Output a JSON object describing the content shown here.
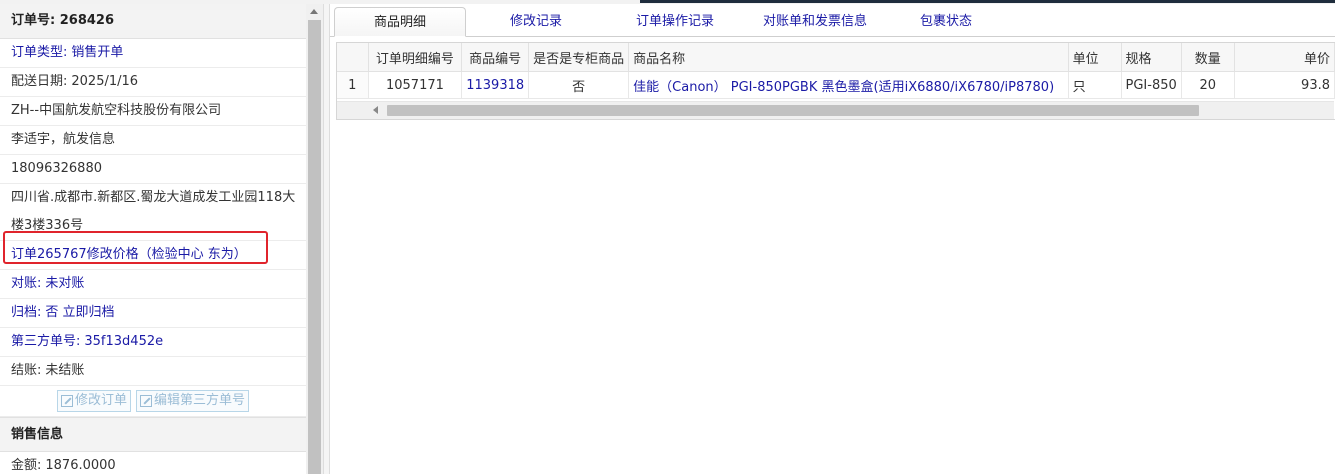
{
  "order": {
    "header_label": "订单号:",
    "number": "268426",
    "type_label": "订单类型:",
    "type_value": "销售开单",
    "delivery_label": "配送日期:",
    "delivery_value": "2025/1/16",
    "company": "ZH--中国航发航空科技股份有限公司",
    "contact": "李适宇，航发信息",
    "phone": "18096326880",
    "address": "四川省.成都市.新都区.蜀龙大道成发工业园118大楼3楼336号",
    "note": "订单265767修改价格（检验中心 东为）",
    "reconcile_label": "对账:",
    "reconcile_value": "未对账",
    "archive_label": "归档:",
    "archive_value": "否 立即归档",
    "third_party_label": "第三方单号:",
    "third_party_value": "35f13d452e",
    "settle_label": "结账:",
    "settle_value": "未结账",
    "edit_order_button": "修改订单",
    "edit_third_button": "编辑第三方单号"
  },
  "sales": {
    "header": "销售信息",
    "amount_label": "金额:",
    "amount_value": "1876.0000"
  },
  "tabs": [
    {
      "label": "商品明细",
      "active": true
    },
    {
      "label": "修改记录",
      "active": false
    },
    {
      "label": "订单操作记录",
      "active": false
    },
    {
      "label": "对账单和发票信息",
      "active": false
    },
    {
      "label": "包裹状态",
      "active": false
    }
  ],
  "grid": {
    "columns": [
      "订单明细编号",
      "商品编号",
      "是否是专柜商品",
      "商品名称",
      "单位",
      "规格",
      "数量",
      "单价"
    ],
    "rows": [
      {
        "row_num": "1",
        "detail_id": "1057171",
        "product_id": "1139318",
        "is_counter": "否",
        "name": "佳能（Canon） PGI-850PGBK 黑色墨盒(适用iX6880/iX6780/iP8780)",
        "unit": "只",
        "spec": "PGI-850",
        "qty": "20",
        "price": "93.8"
      }
    ]
  },
  "colors": {
    "link_blue": "#1a1aa6",
    "highlight_red": "#e0242c"
  }
}
